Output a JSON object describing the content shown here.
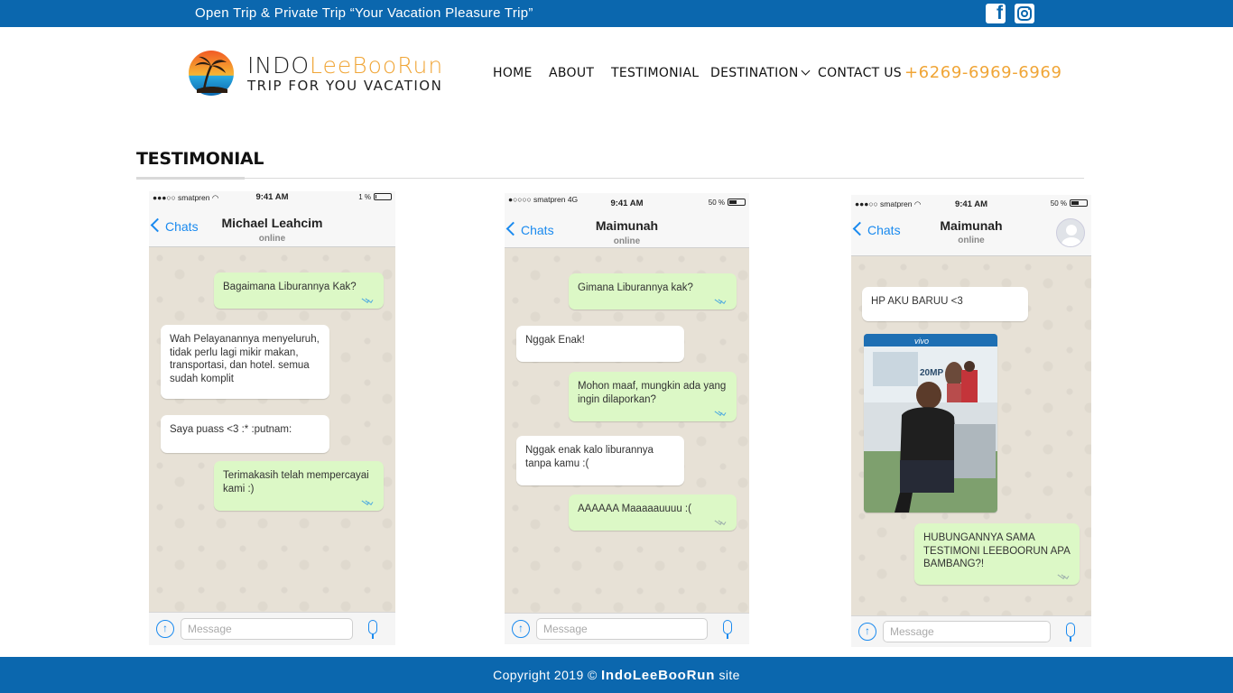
{
  "topbar": {
    "tagline": "Open Trip & Private Trip “Your Vacation Pleasure Trip”",
    "facebook_icon": "facebook-icon",
    "instagram_icon": "instagram-icon"
  },
  "header": {
    "brand_part1": "INDO",
    "brand_part2": "LeeBooRun",
    "brand_sub": "TRIP FOR YOU VACATION",
    "nav": [
      "HOME",
      "ABOUT",
      "TESTIMONIAL",
      "DESTINATION",
      "CONTACT US"
    ],
    "phone": "+6269-6969-6969"
  },
  "section": {
    "title": "TESTIMONIAL"
  },
  "phones": [
    {
      "carrier": "●●●○○ smatpren ◠",
      "time": "9:41 AM",
      "battery": "1 %",
      "battery_level": 0.01,
      "back": "Chats",
      "name": "Michael Leahcim",
      "status": "online",
      "messages": [
        {
          "dir": "out",
          "text": "Bagaimana Liburannya Kak?"
        },
        {
          "dir": "in",
          "text": "Wah Pelayanannya menyeluruh, tidak perlu lagi mikir makan, transportasi, dan hotel. semua sudah komplit"
        },
        {
          "dir": "in",
          "text": "Saya puass <3 :* :putnam:"
        },
        {
          "dir": "out",
          "text": "Terimakasih telah mempercayai kami :)"
        }
      ],
      "input_placeholder": "Message"
    },
    {
      "carrier": "●○○○○ smatpren  4G",
      "time": "9:41 AM",
      "battery": "50 %",
      "battery_level": 0.5,
      "back": "Chats",
      "name": "Maimunah",
      "status": "online",
      "messages": [
        {
          "dir": "out",
          "text": "Gimana Liburannya kak?"
        },
        {
          "dir": "in",
          "text": "Nggak Enak!"
        },
        {
          "dir": "out",
          "text": "Mohon maaf, mungkin ada yang ingin dilaporkan?"
        },
        {
          "dir": "in",
          "text": "Nggak enak kalo liburannya tanpa kamu :("
        },
        {
          "dir": "out",
          "text": "AAAAAA Maaaaauuuu :("
        }
      ],
      "input_placeholder": "Message"
    },
    {
      "carrier": "●●●○○ smatpren ◠",
      "time": "9:41 AM",
      "battery": "50 %",
      "battery_level": 0.5,
      "back": "Chats",
      "name": "Maimunah",
      "status": "online",
      "messages": [
        {
          "dir": "in",
          "text": "HP AKU BARUU <3"
        },
        {
          "dir": "out",
          "text": "HUBUNGANNYA SAMA TESTIMONI LEEBOORUN APA BAMBANG?!"
        }
      ],
      "photo_sign_brand": "vivo",
      "photo_sign_text": "20MP",
      "input_placeholder": "Message"
    }
  ],
  "footer": {
    "prefix": "Copyright 2019 © ",
    "brand": "IndoLeeBooRun",
    "suffix": " site"
  },
  "colors": {
    "primary": "#0b67ae",
    "accent": "#f0a536",
    "bubble_out": "#dcf8c6",
    "chat_bg": "#e7e1d6"
  }
}
